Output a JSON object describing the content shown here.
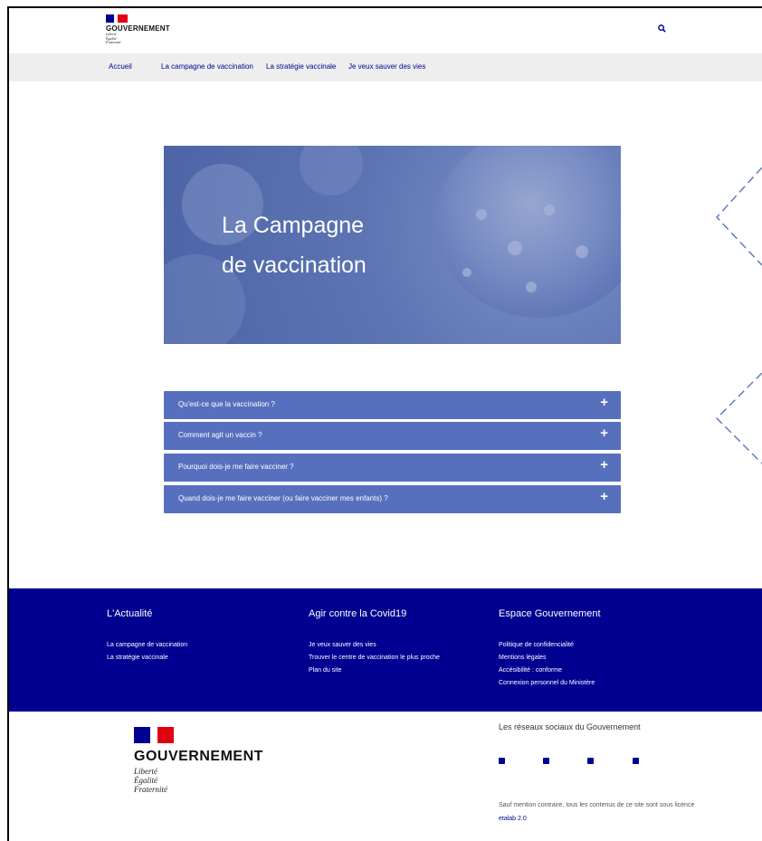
{
  "header": {
    "logo": {
      "title": "GOUVERNEMENT",
      "motto": [
        "Liberté",
        "Égalité",
        "Fraternité"
      ]
    },
    "search_icon": "search-icon"
  },
  "nav": {
    "items": [
      {
        "label": "Accueil"
      },
      {
        "label": "La campagne de vaccination"
      },
      {
        "label": "La stratégie vaccinale"
      },
      {
        "label": "Je veux sauver des vies"
      }
    ]
  },
  "hero": {
    "title_line1": "La Campagne",
    "title_line2": "de vaccination"
  },
  "accordion": [
    {
      "label": "Qu'est-ce que la vaccination ?",
      "icon": "+"
    },
    {
      "label": "Comment agit un vaccin ?",
      "icon": "+"
    },
    {
      "label": "Pourquoi dois-je me faire vacciner ?",
      "icon": "+"
    },
    {
      "label": "Quand dois-je me faire vacciner (ou faire vacciner mes enfants) ?",
      "icon": "+"
    }
  ],
  "footer": {
    "columns": [
      {
        "title": "L'Actualité",
        "links": [
          "La campagne de vaccination",
          "La stratégie vaccinale"
        ]
      },
      {
        "title": "Agir contre la Covid19",
        "links": [
          "Je veux sauver des vies",
          "Trouver le centre de vaccination le plus proche",
          "Plan du site"
        ]
      },
      {
        "title": "Espace Gouvernement",
        "links": [
          "Politique de confidencialité",
          "Mentions légales",
          "Accésibilité : conforme",
          "Connexion personnel du Ministère"
        ]
      }
    ],
    "logo": {
      "title": "GOUVERNEMENT",
      "motto": [
        "Liberté",
        "Égalité",
        "Fraternité"
      ]
    },
    "social": {
      "title": "Les réseaux sociaux du Gouvernement",
      "icons": [
        "facebook-icon",
        "instagram-icon",
        "linkedin-icon",
        "twitter-icon"
      ]
    },
    "license": {
      "text": "Sauf mention contraire, tous les contenus de ce site sont sous licence",
      "link": "etalab 2.0"
    }
  },
  "colors": {
    "brand_blue": "#000091",
    "accordion_blue": "#5770be",
    "nav_gray": "#eeeeee",
    "flag_red": "#e1000f"
  }
}
